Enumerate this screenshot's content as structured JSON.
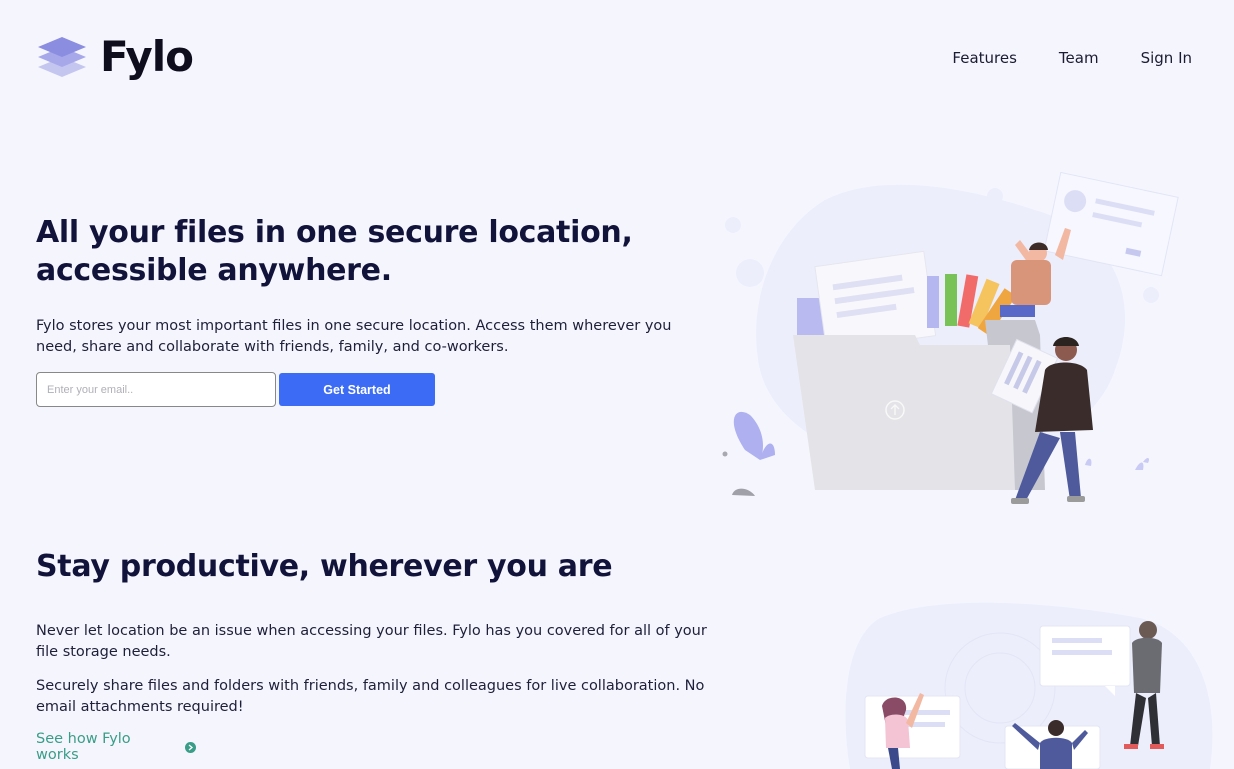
{
  "header": {
    "brand": "Fylo",
    "nav": [
      {
        "label": "Features"
      },
      {
        "label": "Team"
      },
      {
        "label": "Sign In"
      }
    ]
  },
  "hero": {
    "title": "All your files in one secure location, accessible anywhere.",
    "description": "Fylo stores your most important files in one secure location. Access them wherever you need, share and collaborate with friends, family, and co-workers.",
    "email_placeholder": "Enter your email..",
    "cta_label": "Get Started"
  },
  "productive": {
    "title": "Stay productive, wherever you are",
    "p1": "Never let location be an issue when accessing your files. Fylo has you covered for all of your file storage needs.",
    "p2": "Securely share files and folders with friends, family and colleagues for live collaboration. No email attachments required!",
    "link_label": "See how Fylo works"
  },
  "colors": {
    "background": "#f5f6fd",
    "accent_blue": "#3c6cf5",
    "link_teal": "#3a9d87",
    "heading": "#12133a"
  },
  "icons": {
    "logo": "stacked-layers-icon",
    "link_arrow": "arrow-circle-icon"
  }
}
